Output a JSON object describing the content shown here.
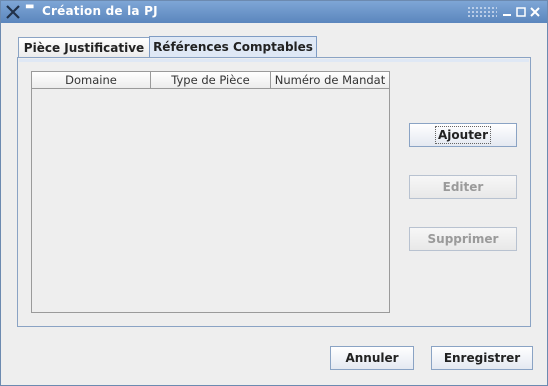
{
  "window": {
    "title": "Création de la PJ",
    "icons": {
      "app": "x-app-icon",
      "system_menu": "minus-menu-icon",
      "minimize": "minimize-icon",
      "maximize": "maximize-icon",
      "close": "close-icon"
    }
  },
  "tabs": [
    {
      "label": "Pièce Justificative",
      "selected": false
    },
    {
      "label": "Références Comptables",
      "selected": true
    }
  ],
  "table": {
    "columns": [
      "Domaine",
      "Type de Pièce",
      "Numéro de Mandat"
    ],
    "rows": []
  },
  "side_buttons": {
    "add": {
      "label": "Ajouter",
      "enabled": true
    },
    "edit": {
      "label": "Editer",
      "enabled": false
    },
    "delete": {
      "label": "Supprimer",
      "enabled": false
    }
  },
  "footer_buttons": {
    "cancel": {
      "label": "Annuler"
    },
    "save": {
      "label": "Enregistrer"
    }
  },
  "colors": {
    "titlebar": "#5b86bd",
    "tab_selected": "#dfe8f5",
    "border": "#8aa3c4",
    "background": "#eeeeee",
    "disabled_text": "#9a9a9a"
  }
}
